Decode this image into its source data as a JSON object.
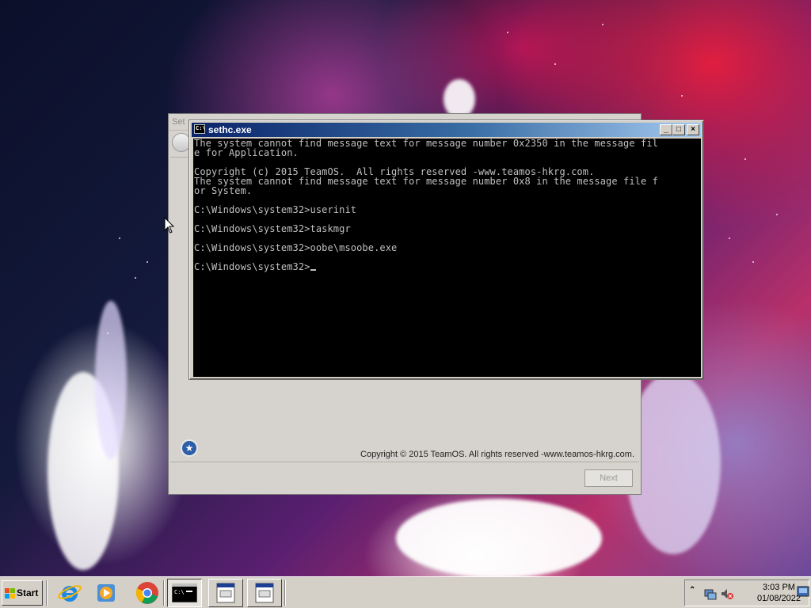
{
  "setup_window": {
    "title": "Set",
    "copyright": "Copyright © 2015 TeamOS.  All rights reserved -www.teamos-hkrg.com.",
    "next_label": "Next"
  },
  "console_window": {
    "title": "sethc.exe",
    "lines": [
      "The system cannot find message text for message number 0x2350 in the message fil",
      "e for Application.",
      "",
      "Copyright (c) 2015 TeamOS.  All rights reserved -www.teamos-hkrg.com.",
      "The system cannot find message text for message number 0x8 in the message file f",
      "or System.",
      "",
      "C:\\Windows\\system32>userinit",
      "",
      "C:\\Windows\\system32>taskmgr",
      "",
      "C:\\Windows\\system32>oobe\\msoobe.exe",
      "",
      "C:\\Windows\\system32>"
    ]
  },
  "taskbar": {
    "start_label": "Start",
    "clock_time": "3:03 PM",
    "clock_date": "01/08/2022"
  },
  "colors": {
    "console_bg": "#000000",
    "console_text": "#c0c0c0",
    "titlebar_active_start": "#0a246a",
    "titlebar_active_end": "#a6caf0",
    "chrome": "#d4d0c8"
  }
}
